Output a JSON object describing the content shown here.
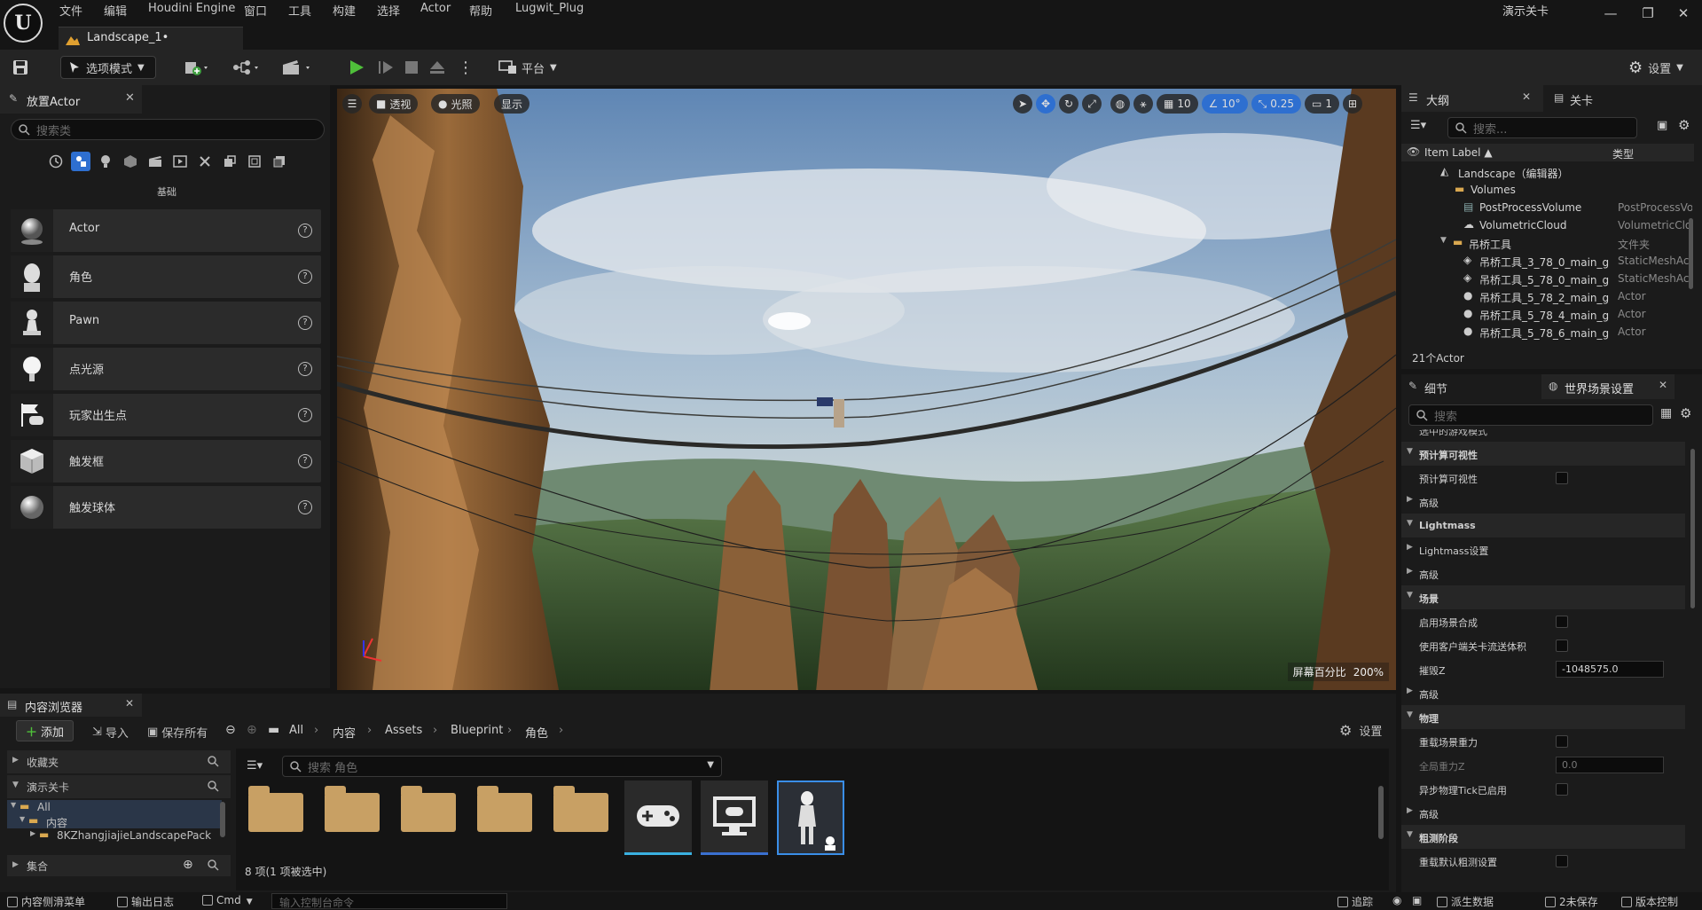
{
  "menu": [
    "文件",
    "编辑",
    "Houdini Engine",
    "窗口",
    "工具",
    "构建",
    "选择",
    "Actor",
    "帮助",
    "Lugwit_Plug"
  ],
  "document_tab": "Landscape_1•",
  "demo_level": "演示关卡",
  "window_buttons": {
    "minimize": "—",
    "restore": "❐",
    "close": "✕"
  },
  "toolbar": {
    "mode": "选项模式",
    "platform": "平台",
    "settings": "设置"
  },
  "place_actor": {
    "tab_title": "放置Actor",
    "search_placeholder": "搜索类",
    "category_label": "基础",
    "items": [
      {
        "label": "Actor",
        "icon": "sphere-icon"
      },
      {
        "label": "角色",
        "icon": "character-icon"
      },
      {
        "label": "Pawn",
        "icon": "pawn-icon"
      },
      {
        "label": "点光源",
        "icon": "point-light-icon"
      },
      {
        "label": "玩家出生点",
        "icon": "player-start-icon"
      },
      {
        "label": "触发框",
        "icon": "trigger-box-icon"
      },
      {
        "label": "触发球体",
        "icon": "trigger-sphere-icon"
      }
    ]
  },
  "viewport": {
    "perspective": "透视",
    "lighting": "光照",
    "show": "显示",
    "grid_size": "10",
    "rotation_snap": "10°",
    "scale_snap": "0.25",
    "camera_speed": "1",
    "screen_percentage": "屏幕百分比",
    "screen_percentage_value": "200%"
  },
  "outliner": {
    "tab_title": "大纲",
    "tab_level": "关卡",
    "search_placeholder": "搜索...",
    "col_label": "Item Label ▲",
    "col_type": "类型",
    "rows": [
      {
        "label": "Landscape（编辑器）",
        "type": ""
      },
      {
        "label": "Volumes",
        "type": ""
      },
      {
        "label": "PostProcessVolume",
        "type": "PostProcessVolume"
      },
      {
        "label": "VolumetricCloud",
        "type": "VolumetricCloud"
      },
      {
        "label": "吊桥工具",
        "type": "文件夹"
      },
      {
        "label": "吊桥工具_3_78_0_main_g",
        "type": "StaticMeshActor"
      },
      {
        "label": "吊桥工具_5_78_0_main_g",
        "type": "StaticMeshActor"
      },
      {
        "label": "吊桥工具_5_78_2_main_g",
        "type": "Actor"
      },
      {
        "label": "吊桥工具_5_78_4_main_g",
        "type": "Actor"
      },
      {
        "label": "吊桥工具_5_78_6_main_g",
        "type": "Actor"
      }
    ],
    "count": "21个Actor"
  },
  "details": {
    "tab_details": "细节",
    "tab_world": "世界场景设置",
    "search_placeholder": "搜索",
    "cut_row": "选中的游戏模式",
    "rows": [
      {
        "kind": "cat",
        "label": "预计算可视性"
      },
      {
        "kind": "check",
        "label": "预计算可视性"
      },
      {
        "kind": "sub",
        "label": "高级"
      },
      {
        "kind": "cat",
        "label": "Lightmass"
      },
      {
        "kind": "sub",
        "label": "Lightmass设置"
      },
      {
        "kind": "sub",
        "label": "高级"
      },
      {
        "kind": "cat",
        "label": "场景"
      },
      {
        "kind": "check",
        "label": "启用场景合成"
      },
      {
        "kind": "check",
        "label": "使用客户端关卡流送体积"
      },
      {
        "kind": "value",
        "label": "摧毁Z",
        "value": "-1048575.0"
      },
      {
        "kind": "sub",
        "label": "高级"
      },
      {
        "kind": "cat",
        "label": "物理"
      },
      {
        "kind": "check",
        "label": "重载场景重力"
      },
      {
        "kind": "value",
        "label": "全局重力Z",
        "value": "0.0"
      },
      {
        "kind": "check",
        "label": "异步物理Tick已启用"
      },
      {
        "kind": "sub",
        "label": "高级"
      },
      {
        "kind": "cat",
        "label": "粗测阶段"
      },
      {
        "kind": "check",
        "label": "重载默认粗测设置"
      }
    ]
  },
  "content_browser": {
    "tab_title": "内容浏览器",
    "add": "添加",
    "import": "导入",
    "save_all": "保存所有",
    "breadcrumb": [
      "All",
      "内容",
      "Assets",
      "Blueprint",
      "角色"
    ],
    "settings": "设置",
    "favorites": "收藏夹",
    "demo_level": "演示关卡",
    "tree": [
      "All",
      "内容",
      "8KZhangjiajieLandscapePack"
    ],
    "collections": "集合",
    "search_placeholder": "搜索 角色",
    "status": "8 项(1 项被选中)"
  },
  "statusbar": {
    "content_drawer": "内容侧滑菜单",
    "output_log": "输出日志",
    "cmd": "Cmd",
    "console_placeholder": "输入控制台命令",
    "trace": "追踪",
    "derived_data": "派生数据",
    "unsaved": "2未保存",
    "source_control": "版本控制"
  }
}
